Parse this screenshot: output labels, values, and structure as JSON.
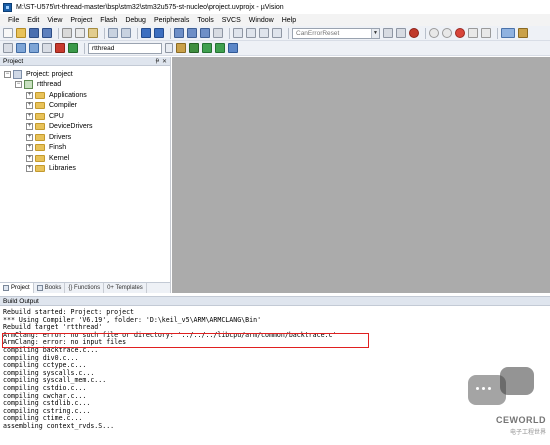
{
  "window": {
    "title": "M:\\ST-U575\\rt-thread-master\\bsp\\stm32\\stm32u575-st-nucleo\\project.uvprojx - µVision"
  },
  "menu": [
    "File",
    "Edit",
    "View",
    "Project",
    "Flash",
    "Debug",
    "Peripherals",
    "Tools",
    "SVCS",
    "Window",
    "Help"
  ],
  "toolbar": {
    "find_combo_value": "CanErrorReset",
    "target_combo_value": "rtthread"
  },
  "project_panel": {
    "header": "Project",
    "pin_glyph": "ᵽ",
    "close_glyph": "✕",
    "project_label": "Project: project",
    "target_label": "rtthread",
    "groups": [
      "Applications",
      "Compiler",
      "CPU",
      "DeviceDrivers",
      "Drivers",
      "Finsh",
      "Kernel",
      "Libraries"
    ],
    "tabs": [
      "Project",
      "Books",
      "{} Functions",
      "0+ Templates"
    ]
  },
  "build_output": {
    "header": "Build Output",
    "lines": [
      "Rebuild started: Project: project",
      "*** Using Compiler 'V6.19', folder: 'D:\\keil_v5\\ARM\\ARMCLANG\\Bin'",
      "Rebuild target 'rtthread'",
      "ArmClang: error: no such file or directory: '../../../libcpu/arm/common/backtrace.c'",
      "ArmClang: error: no input files",
      "compiling backtrace.c...",
      "compiling div0.c...",
      "compiling cctype.c...",
      "compiling syscalls.c...",
      "compiling syscall_mem.c...",
      "compiling cstdio.c...",
      "compiling cwchar.c...",
      "compiling cstdlib.c...",
      "compiling cstring.c...",
      "compiling ctime.c...",
      "assembling context_rvds.S..."
    ]
  },
  "watermark": {
    "text": "CEWORLD",
    "subtext": "电子工程世界"
  },
  "colors": {
    "editor_background": "#ababab",
    "highlight_border": "#e02020",
    "panel_header": "#dfe5ee"
  }
}
